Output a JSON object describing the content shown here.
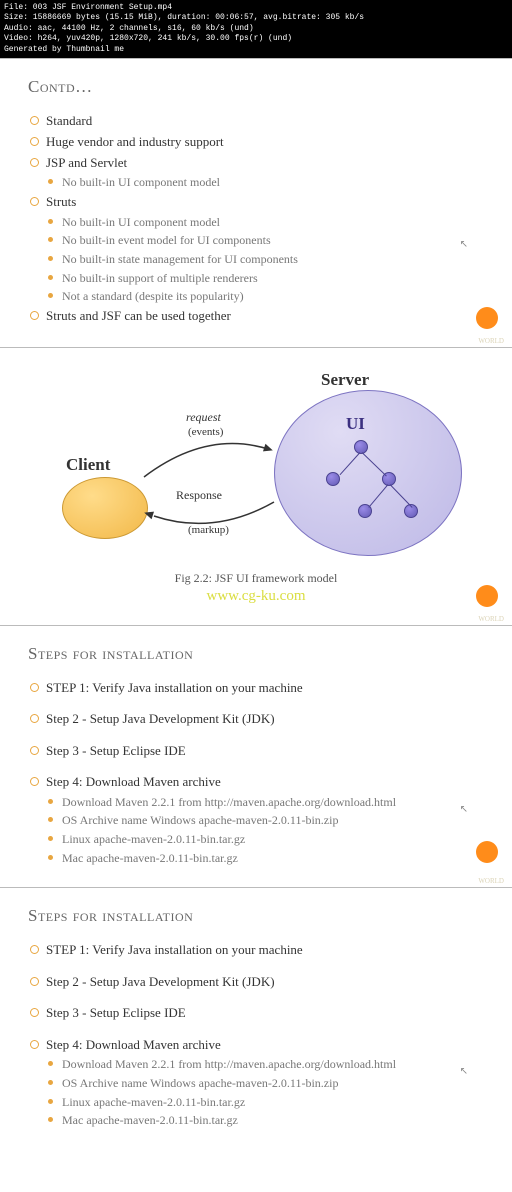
{
  "header": {
    "line1": "File: 003 JSF Environment Setup.mp4",
    "line2": "Size: 15886669 bytes (15.15 MiB), duration: 00:06:57, avg.bitrate: 305 kb/s",
    "line3": "Audio: aac, 44100 Hz, 2 channels, s16, 60 kb/s (und)",
    "line4": "Video: h264, yuv420p, 1280x720, 241 kb/s, 30.00 fps(r) (und)",
    "line5": "Generated by Thumbnail me"
  },
  "slide1": {
    "title": "Contd…",
    "bullets": [
      "Standard",
      "Huge vendor and industry support",
      "JSP and Servlet",
      "Struts",
      "Struts and JSF can be used together"
    ],
    "jsp_sub": "No built-in UI component model",
    "struts_sub": [
      "No built-in UI component model",
      "No built-in event model for UI components",
      "No built-in state management for UI components",
      "No built-in support of multiple renderers",
      "Not a standard (despite its popularity)"
    ]
  },
  "slide2": {
    "server_label": "Server",
    "client_label": "Client",
    "ui_label": "UI",
    "request_label": "request",
    "request_sub": "(events)",
    "response_label": "Response",
    "response_sub": "(markup)",
    "caption": "Fig 2.2: JSF UI framework model",
    "watermark": "www.cg-ku.com"
  },
  "slide3": {
    "title": "Steps for installation",
    "steps": [
      "STEP 1: Verify Java installation on your machine",
      "Step 2 - Setup Java Development Kit (JDK)",
      "Step 3 - Setup Eclipse IDE",
      "Step 4: Download Maven archive"
    ],
    "maven_sub": [
      "Download Maven 2.2.1 from http://maven.apache.org/download.html",
      "OS Archive name Windows apache-maven-2.0.11-bin.zip",
      "Linux apache-maven-2.0.11-bin.tar.gz",
      "Mac apache-maven-2.0.11-bin.tar.gz"
    ]
  },
  "footer_text": "WORLD"
}
